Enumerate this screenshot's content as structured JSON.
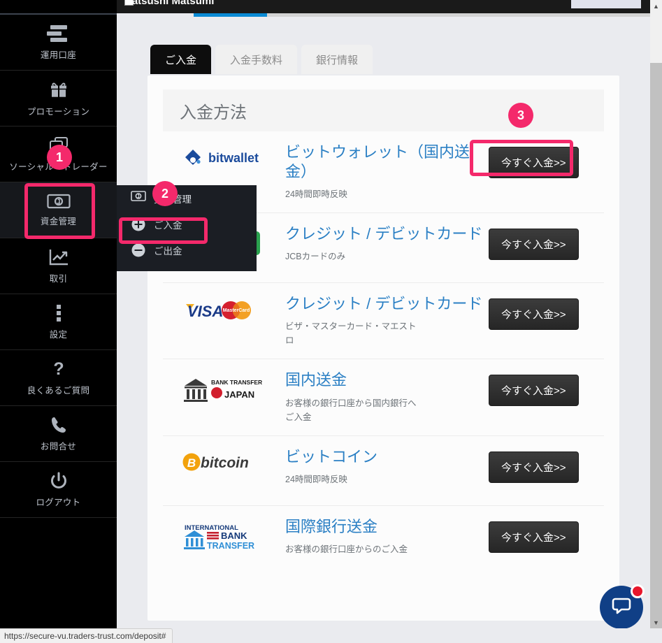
{
  "browser": {
    "status_url": "https://secure-vu.traders-trust.com/deposit#",
    "scroll_up_glyph": "▲",
    "scroll_down_glyph": "▼"
  },
  "header": {
    "username": "Katsushi Matsumi"
  },
  "sidebar": {
    "items": [
      {
        "label": "運用口座",
        "icon": "accounts-icon",
        "active": false
      },
      {
        "label": "プロモーション",
        "icon": "gift-icon",
        "active": false
      },
      {
        "label": "ソーシャル・トレーダー",
        "icon": "social-trader-icon",
        "active": false
      },
      {
        "label": "資金管理",
        "icon": "funds-icon",
        "active": true
      },
      {
        "label": "取引",
        "icon": "chart-icon",
        "active": false
      },
      {
        "label": "設定",
        "icon": "settings-dots-icon",
        "active": false
      },
      {
        "label": "良くあるご質問",
        "icon": "question-mark-icon",
        "active": false
      },
      {
        "label": "お問合せ",
        "icon": "phone-icon",
        "active": false
      },
      {
        "label": "ログアウト",
        "icon": "power-icon",
        "active": false
      }
    ]
  },
  "submenu": {
    "items": [
      {
        "label": "資金管理",
        "icon": "funds-icon"
      },
      {
        "label": "ご入金",
        "icon": "plus-circle-icon"
      },
      {
        "label": "ご出金",
        "icon": "minus-circle-icon"
      }
    ]
  },
  "tabs": [
    {
      "label": "ご入金",
      "active": true
    },
    {
      "label": "入金手数料",
      "active": false
    },
    {
      "label": "銀行情報",
      "active": false
    }
  ],
  "panel": {
    "title": "入金方法",
    "methods": [
      {
        "logo": "bitwallet-logo",
        "title": "ビットウォレット（国内送金）",
        "subtitle": "24時間即時反映",
        "button": "今すぐ入金>>"
      },
      {
        "logo": "jcb-logo",
        "title": "クレジット / デビットカード",
        "subtitle": "JCBカードのみ",
        "button": "今すぐ入金>>"
      },
      {
        "logo": "visa-mastercard-logo",
        "title": "クレジット / デビットカード",
        "subtitle": "ビザ・マスターカード・マエストロ",
        "button": "今すぐ入金>>"
      },
      {
        "logo": "bank-transfer-japan-logo",
        "title": "国内送金",
        "subtitle": "お客様の銀行口座から国内銀行へご入金",
        "button": "今すぐ入金>>"
      },
      {
        "logo": "bitcoin-logo",
        "title": "ビットコイン",
        "subtitle": "24時間即時反映",
        "button": "今すぐ入金>>"
      },
      {
        "logo": "international-bank-transfer-logo",
        "title": "国際銀行送金",
        "subtitle": "お客様の銀行口座からのご入金",
        "button": "今すぐ入金>>"
      }
    ]
  },
  "annotations": {
    "accent_color": "#f4296b",
    "markers": [
      {
        "label": "1"
      },
      {
        "label": "2"
      },
      {
        "label": "3"
      }
    ]
  },
  "chat": {
    "tooltip": "live-chat"
  }
}
